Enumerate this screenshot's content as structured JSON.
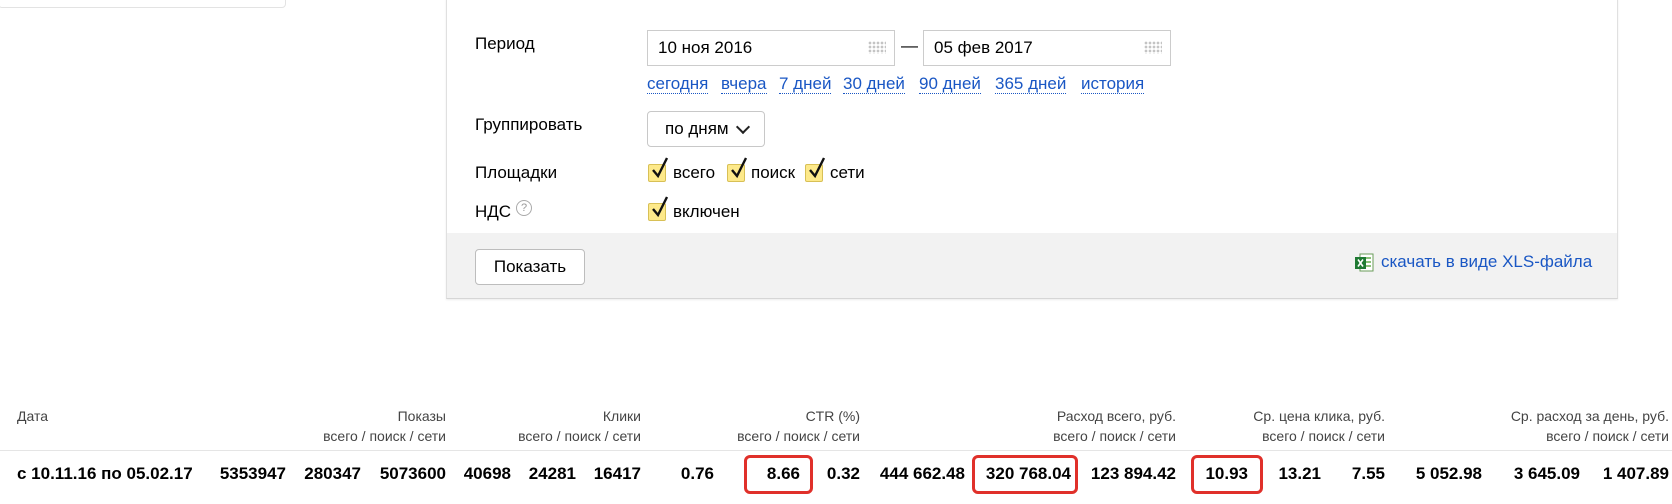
{
  "filters": {
    "period_label": "Период",
    "date_from": "10 ноя 2016",
    "date_sep": "—",
    "date_to": "05 фев 2017",
    "quick_periods": [
      "сегодня",
      "вчера",
      "7 дней",
      "30 дней",
      "90 дней",
      "365 дней",
      "история"
    ],
    "group_label": "Группировать",
    "group_value": "по дням",
    "platforms_label": "Площадки",
    "platforms": [
      "всего",
      "поиск",
      "сети"
    ],
    "vat_label": "НДС",
    "vat_help": "?",
    "vat_value": "включен",
    "show_button": "Показать",
    "xls_link": "скачать в виде XLS-файла"
  },
  "table": {
    "headers": [
      {
        "title": "Дата",
        "sub": ""
      },
      {
        "title": "Показы",
        "sub": "всего / поиск / сети"
      },
      {
        "title": "Клики",
        "sub": "всего / поиск / сети"
      },
      {
        "title": "CTR (%)",
        "sub": "всего / поиск / сети"
      },
      {
        "title": "Расход всего, руб.",
        "sub": "всего / поиск / сети"
      },
      {
        "title": "Ср. цена клика, руб.",
        "sub": "всего / поиск / сети"
      },
      {
        "title": "Ср. расход за день, руб.",
        "sub": "всего / поиск / сети"
      }
    ],
    "row": {
      "date": "с 10.11.16 по 05.02.17",
      "shows": [
        "5353947",
        "280347",
        "5073600"
      ],
      "clicks": [
        "40698",
        "24281",
        "16417"
      ],
      "ctr": [
        "0.76",
        "8.66",
        "0.32"
      ],
      "cost": [
        "444 662.48",
        "320 768.04",
        "123 894.42"
      ],
      "cpc": [
        "10.93",
        "13.21",
        "7.55"
      ],
      "daily": [
        "5 052.98",
        "3 645.09",
        "1 407.89"
      ]
    },
    "highlight_color": "#e0302a"
  }
}
